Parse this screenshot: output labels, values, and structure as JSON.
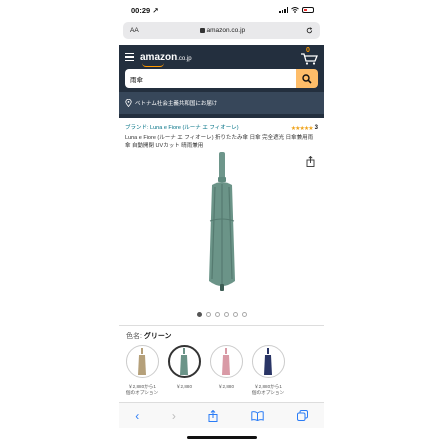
{
  "status": {
    "time": "00:29",
    "location_arrow": "↗"
  },
  "browser": {
    "text_size_label": "AA",
    "address": "amazon.co.jp"
  },
  "header": {
    "logo_text": "amazon",
    "logo_suffix": ".co.jp",
    "cart_count": "0"
  },
  "search": {
    "value": "雨傘"
  },
  "delivery": {
    "text": "ベトナム社会主義共和国にお届け"
  },
  "product": {
    "brand_line": "ブランド: Luna e Fiore (ルーナ エ フィオーレ)",
    "stars": "★★★★★",
    "rating_count": "3",
    "title": "Luna e Fiore (ルーナ エ フィオーレ) 折りたたみ傘 日傘 完全遮光 日傘兼用雨傘 自動開閉 UVカット 晴雨兼用",
    "image_count": 6,
    "active_image": 0
  },
  "colors": {
    "label_prefix": "色名:",
    "selected": "グリーン",
    "options": [
      {
        "name": "beige",
        "price_line1": "￥2,880から1",
        "price_line2": "個のオプション",
        "color": "#b5a07a",
        "selected": false
      },
      {
        "name": "green",
        "price_line1": "￥2,880",
        "price_line2": "",
        "color": "#6b9488",
        "selected": true
      },
      {
        "name": "pink",
        "price_line1": "￥2,880",
        "price_line2": "",
        "color": "#d99aa6",
        "selected": false
      },
      {
        "name": "navy",
        "price_line1": "￥2,880から1",
        "price_line2": "個のオプション",
        "color": "#2a3566",
        "selected": false
      }
    ]
  },
  "toolbar": {
    "back": "‹",
    "forward": "›"
  },
  "accent": {
    "amazon_dark": "#232f3e",
    "amazon_orange": "#ff9900",
    "search_button": "#febd69",
    "ios_blue": "#2a7cf6"
  }
}
